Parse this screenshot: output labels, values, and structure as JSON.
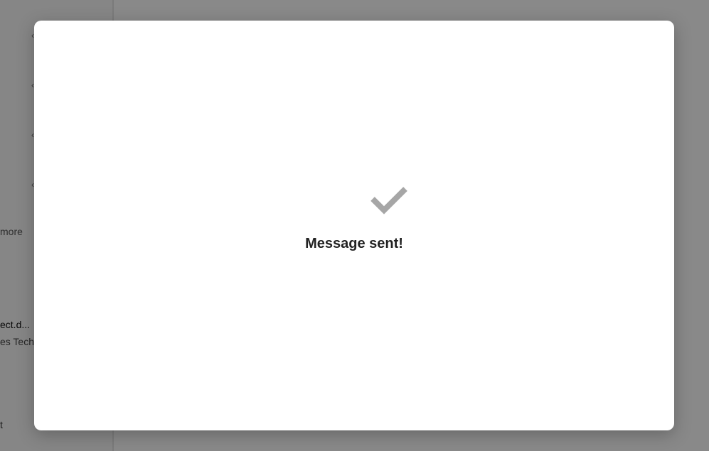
{
  "background": {
    "sidebar": {
      "more_label": "more",
      "email_subject": "ect.d...",
      "email_from": "es TechD",
      "bottom_label": "t"
    }
  },
  "dialog": {
    "icon": "checkmark-icon",
    "message": "Message sent!",
    "icon_color": "#a6a6a6"
  },
  "colors": {
    "overlay": "#000000",
    "dialog_bg": "#ffffff",
    "text": "#222222"
  }
}
